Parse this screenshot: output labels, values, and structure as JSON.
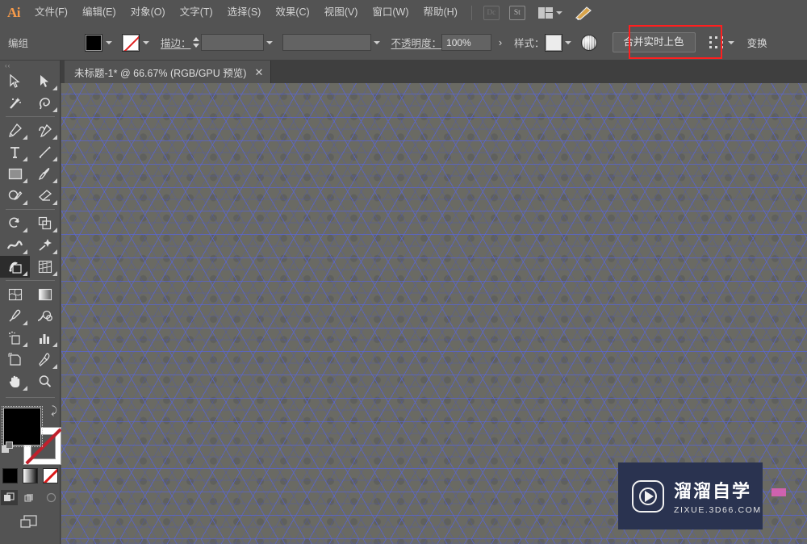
{
  "app": {
    "logo": "Ai",
    "accent_orange": "#f59a4b",
    "highlight_color": "#ff1f1f",
    "chrome_bg": "#535353",
    "canvas_bg": "#6a6a63",
    "grid_line_color": "#5c68d6"
  },
  "menubar": {
    "items": [
      {
        "label": "文件(F)",
        "name": "menu-file"
      },
      {
        "label": "编辑(E)",
        "name": "menu-edit"
      },
      {
        "label": "对象(O)",
        "name": "menu-object"
      },
      {
        "label": "文字(T)",
        "name": "menu-type"
      },
      {
        "label": "选择(S)",
        "name": "menu-select"
      },
      {
        "label": "效果(C)",
        "name": "menu-effect"
      },
      {
        "label": "视图(V)",
        "name": "menu-view"
      },
      {
        "label": "窗口(W)",
        "name": "menu-window"
      },
      {
        "label": "帮助(H)",
        "name": "menu-help"
      }
    ],
    "right_icons": [
      {
        "label": "Dc",
        "name": "document-cloud-icon",
        "dim": true
      },
      {
        "label": "St",
        "name": "adobe-stock-icon",
        "dim": false
      }
    ],
    "workspace_switcher": "workspace-layout-icon",
    "brush_icon": "brush-icon"
  },
  "controlbar": {
    "selection_label": "编组",
    "fill": {
      "label": "fill-swatch",
      "color": "#000000"
    },
    "stroke": {
      "label": "stroke-swatch",
      "color": "none"
    },
    "stroke_label": "描边：",
    "stroke_weight_value": "",
    "stroke_profile_value": "",
    "opacity_label": "不透明度：",
    "opacity_value": "100%",
    "opacity_more": "›",
    "style_label": "样式：",
    "style_swatch": "#ececec",
    "appearance_icon": "appearance-sphere-icon",
    "merge_live_paint_label": "合并实时上色",
    "select_similar_icon": "select-similar-icon",
    "transform_label": "变换"
  },
  "tabbar": {
    "tab_title": "未标题-1* @ 66.67% (RGB/GPU 预览)",
    "close_glyph": "✕"
  },
  "toolbar": {
    "grip": "‹‹",
    "groups": [
      [
        {
          "name": "selection-tool",
          "icon": "arrow-cursor"
        },
        {
          "name": "direct-selection-tool",
          "icon": "filled-arrow-cursor"
        },
        {
          "name": "magic-wand-tool",
          "icon": "magic-wand"
        },
        {
          "name": "lasso-tool",
          "icon": "lasso"
        }
      ],
      [
        {
          "name": "pen-tool",
          "icon": "pen"
        },
        {
          "name": "curvature-tool",
          "icon": "curvature-pen"
        },
        {
          "name": "type-tool",
          "icon": "type-T"
        },
        {
          "name": "line-segment-tool",
          "icon": "line-diagonal"
        },
        {
          "name": "rectangle-tool",
          "icon": "rectangle"
        },
        {
          "name": "paintbrush-tool",
          "icon": "paintbrush"
        },
        {
          "name": "shaper-tool",
          "icon": "shaper-pencil"
        },
        {
          "name": "eraser-tool",
          "icon": "eraser"
        }
      ],
      [
        {
          "name": "rotate-tool",
          "icon": "rotate-arrow"
        },
        {
          "name": "scale-tool",
          "icon": "scale-box"
        },
        {
          "name": "width-tool",
          "icon": "width-warp"
        },
        {
          "name": "free-transform-tool",
          "icon": "free-transform-star"
        },
        {
          "name": "shape-builder-tool",
          "icon": "shape-builder",
          "active": true
        },
        {
          "name": "perspective-grid-tool",
          "icon": "perspective-grid"
        }
      ],
      [
        {
          "name": "mesh-tool",
          "icon": "mesh"
        },
        {
          "name": "gradient-tool",
          "icon": "gradient-square"
        },
        {
          "name": "eyedropper-tool",
          "icon": "eyedropper"
        },
        {
          "name": "blend-tool",
          "icon": "blend-rings"
        },
        {
          "name": "symbol-sprayer-tool",
          "icon": "symbol-sprayer"
        },
        {
          "name": "column-graph-tool",
          "icon": "bar-chart"
        },
        {
          "name": "artboard-tool",
          "icon": "artboard"
        },
        {
          "name": "slice-tool",
          "icon": "slice-knife"
        },
        {
          "name": "hand-tool",
          "icon": "hand"
        },
        {
          "name": "zoom-tool",
          "icon": "magnifier"
        }
      ]
    ],
    "fill_stroke": {
      "fill_color": "#000000",
      "stroke_color": "none",
      "swap_icon": "swap-fill-stroke-icon",
      "default_icon": "default-fill-stroke-icon"
    },
    "color_modes": [
      {
        "name": "color-mode-solid",
        "icon": "solid-color-icon"
      },
      {
        "name": "color-mode-gradient",
        "icon": "gradient-icon"
      },
      {
        "name": "color-mode-none",
        "icon": "none-color-icon"
      }
    ],
    "draw_modes": [
      {
        "name": "draw-normal-mode",
        "icon": "draw-normal-icon",
        "active": true
      },
      {
        "name": "draw-behind-mode",
        "icon": "draw-behind-icon",
        "active": false
      },
      {
        "name": "draw-inside-mode",
        "icon": "draw-inside-icon",
        "active": false
      }
    ],
    "screen_mode": {
      "name": "change-screen-mode",
      "icon": "screen-mode-icon"
    }
  },
  "canvas": {
    "pattern": "triangular-live-paint-grid",
    "zoom": "66.67%"
  },
  "watermark": {
    "logo": "play-button-logo",
    "title": "溜溜自学",
    "subtitle": "ZIXUE.3D66.COM"
  }
}
